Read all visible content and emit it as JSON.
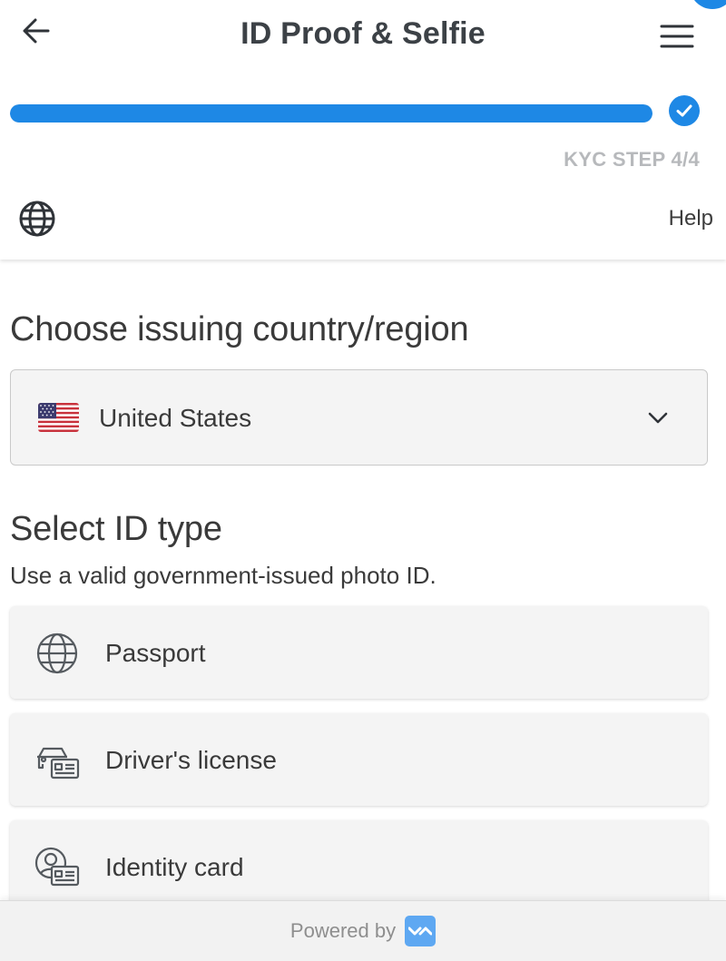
{
  "header": {
    "title": "ID Proof & Selfie",
    "back_icon": "arrow-left-icon",
    "menu_icon": "hamburger-menu-icon",
    "progress_fraction": 1.0,
    "step_label": "KYC STEP 4/4",
    "step_complete_icon": "check-circle-icon",
    "language_icon": "globe-icon",
    "help_label": "Help"
  },
  "country": {
    "heading": "Choose issuing country/region",
    "selected": "United States",
    "flag_icon": "us-flag-icon",
    "dropdown_icon": "chevron-down-icon"
  },
  "id_type": {
    "heading": "Select ID type",
    "subtitle": "Use a valid government-issued photo ID.",
    "options": [
      {
        "label": "Passport",
        "icon": "globe-icon"
      },
      {
        "label": "Driver's license",
        "icon": "car-id-icon"
      },
      {
        "label": "Identity card",
        "icon": "person-id-icon"
      }
    ]
  },
  "footer": {
    "powered_by": "Powered by",
    "logo_icon": "brand-logo-icon"
  },
  "colors": {
    "accent": "#1e88e5",
    "text": "#3a3a3a",
    "muted": "#b7b9bc",
    "card_bg": "#f4f4f4"
  }
}
